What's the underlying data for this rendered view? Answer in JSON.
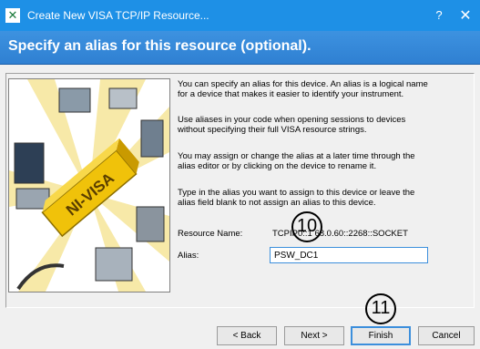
{
  "window": {
    "title": "Create New VISA TCP/IP Resource...",
    "icon": "ni-x-icon",
    "help_label": "?",
    "close_label": "✕"
  },
  "banner": {
    "heading": "Specify an alias for this resource (optional)."
  },
  "illustration": {
    "logo_text": "NI-VISA"
  },
  "description": {
    "p1_line1": "You can specify an alias for this device. An alias is a logical name",
    "p1_line2": "for a device that makes it easier to identify your instrument.",
    "p2_line1": "Use aliases in your code when opening sessions to devices",
    "p2_line2": "without specifying their full VISA resource strings.",
    "p3_line1": "You may assign or change the alias at a later time through the",
    "p3_line2": "alias editor or by clicking on the device to rename it.",
    "p4_line1": "Type in the alias you want to assign to this device or leave the",
    "p4_line2": "alias field blank to not assign an alias to this device."
  },
  "form": {
    "resource_name_label": "Resource Name:",
    "resource_name_value": "TCPIP0::1  68.0.60::2268::SOCKET",
    "alias_label": "Alias:",
    "alias_value": "PSW_DC1"
  },
  "callouts": {
    "step10": "10",
    "step11": "11"
  },
  "buttons": {
    "back": "< Back",
    "next": "Next >",
    "finish": "Finish",
    "cancel": "Cancel"
  },
  "colors": {
    "titlebar": "#1e90e6",
    "banner": "#2f80d2",
    "focus": "#3c8fdc"
  }
}
